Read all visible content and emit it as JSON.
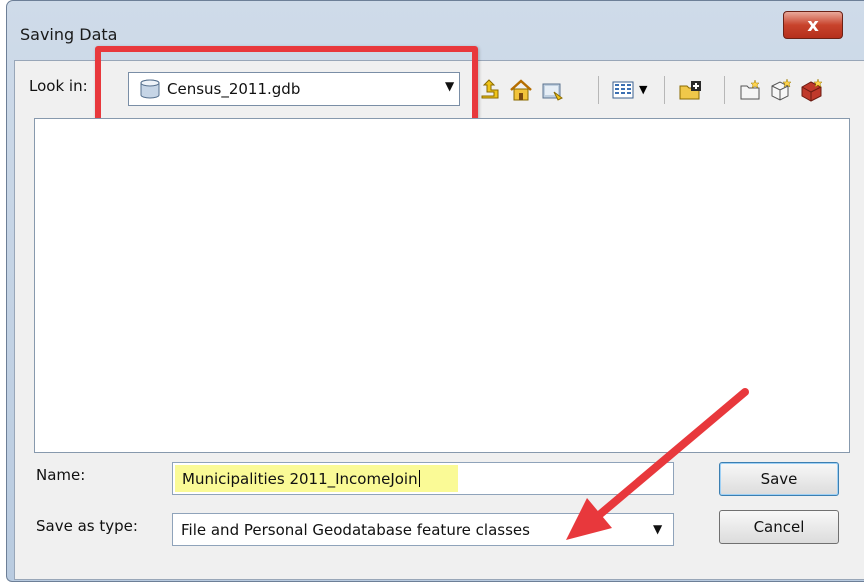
{
  "dialog": {
    "title": "Saving Data",
    "close_label": "x"
  },
  "look_in": {
    "label": "Look in:",
    "value": "Census_2011.gdb"
  },
  "toolbar": {
    "icons": [
      "up-one-level-icon",
      "home-icon",
      "catalog-location-icon",
      "view-list-icon",
      "view-menu-arrow-icon",
      "connect-folder-icon",
      "new-folder-icon",
      "new-feature-class-icon",
      "new-table-icon"
    ]
  },
  "form": {
    "name_label": "Name:",
    "name_value": "Municipalities 2011_IncomeJoin",
    "type_label": "Save as type:",
    "type_value": "File and Personal Geodatabase feature classes"
  },
  "buttons": {
    "save": "Save",
    "cancel": "Cancel"
  },
  "colors": {
    "annotation_red": "#e8383c",
    "name_highlight": "#fafa96"
  }
}
